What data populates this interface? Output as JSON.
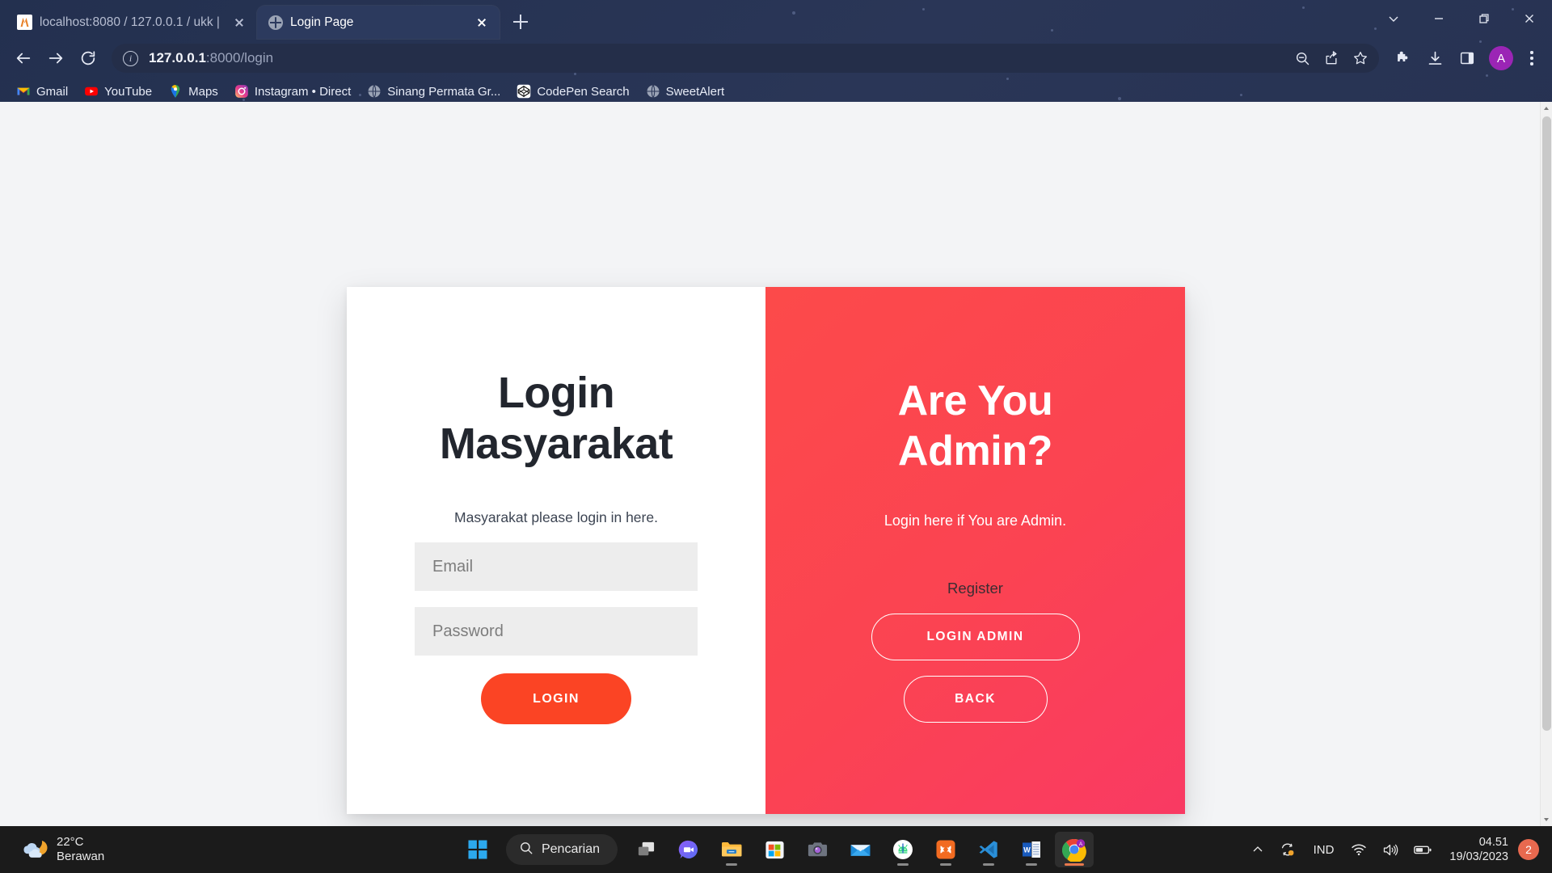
{
  "browser": {
    "tabs": [
      {
        "title": "localhost:8080 / 127.0.0.1 / ukk |",
        "favicon": "phpmyadmin-icon",
        "active": false
      },
      {
        "title": "Login Page",
        "favicon": "globe-icon",
        "active": true
      }
    ],
    "new_tab_label": "+",
    "omnibox": {
      "url_host": "127.0.0.1",
      "url_rest": ":8000/login",
      "full_url": "127.0.0.1:8000/login"
    },
    "avatar_letter": "A",
    "bookmarks": [
      {
        "label": "Gmail",
        "icon": "gmail-icon"
      },
      {
        "label": "YouTube",
        "icon": "youtube-icon"
      },
      {
        "label": "Maps",
        "icon": "google-maps-icon"
      },
      {
        "label": "Instagram • Direct",
        "icon": "instagram-icon"
      },
      {
        "label": "Sinang Permata Gr...",
        "icon": "globe-icon"
      },
      {
        "label": "CodePen Search",
        "icon": "codepen-icon"
      },
      {
        "label": "SweetAlert",
        "icon": "globe-icon"
      }
    ],
    "toolbar_icons": [
      "back-icon",
      "forward-icon",
      "reload-icon",
      "zoom-out-icon",
      "share-icon",
      "bookmark-star-icon",
      "extensions-puzzle-icon",
      "download-icon",
      "side-panel-icon",
      "profile-avatar",
      "kebab-menu-icon"
    ],
    "window_controls": [
      "tab-search-chevron-icon",
      "minimize-icon",
      "restore-icon",
      "close-icon"
    ]
  },
  "page": {
    "left": {
      "title_line1": "Login",
      "title_line2": "Masyarakat",
      "subtitle": "Masyarakat please login in here.",
      "email_placeholder": "Email",
      "email_value": "",
      "password_placeholder": "Password",
      "password_value": "",
      "login_button": "LOGIN"
    },
    "right": {
      "title_line1": "Are You",
      "title_line2": "Admin?",
      "subtitle": "Login here if You are Admin.",
      "register_label": "Register",
      "login_admin_button": "LOGIN ADMIN",
      "back_button": "BACK"
    },
    "colors": {
      "page_background": "#f3f4f6",
      "card_white": "#ffffff",
      "accent_red": "#fb4352",
      "login_button": "#fb4424",
      "field_background": "#ededed",
      "heading_text": "#22262e"
    }
  },
  "taskbar": {
    "weather": {
      "temperature": "22°C",
      "condition": "Berawan",
      "icon": "cloud-moon-icon"
    },
    "start_label": "start-button",
    "search_placeholder": "Pencarian",
    "search_icon": "search-icon",
    "pinned": [
      {
        "name": "task-view-icon",
        "running": false
      },
      {
        "name": "chat-teams-icon",
        "running": false
      },
      {
        "name": "file-explorer-icon",
        "running": true
      },
      {
        "name": "microsoft-store-icon",
        "running": false
      },
      {
        "name": "camera-icon",
        "running": false
      },
      {
        "name": "mail-icon",
        "running": false
      },
      {
        "name": "android-studio-icon",
        "running": true
      },
      {
        "name": "xampp-icon",
        "running": true
      },
      {
        "name": "vscode-icon",
        "running": true
      },
      {
        "name": "word-icon",
        "running": true
      },
      {
        "name": "chrome-icon",
        "running": true,
        "active": true
      }
    ],
    "tray": {
      "overflow_icon": "chevron-up-icon",
      "sync_icon": "onedrive-sync-icon",
      "language": "IND",
      "wifi_icon": "wifi-icon",
      "volume_icon": "volume-icon",
      "battery_icon": "battery-icon",
      "time": "04.51",
      "date": "19/03/2023",
      "notification_count": "2"
    }
  }
}
